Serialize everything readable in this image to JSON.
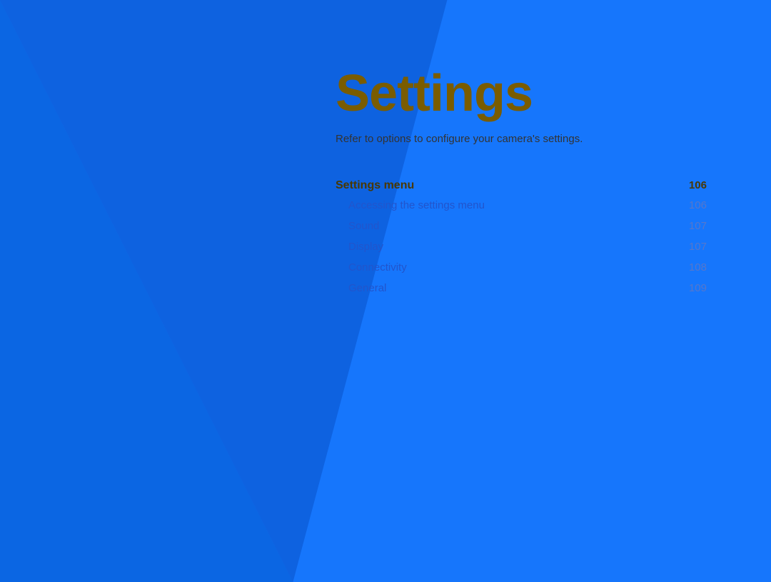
{
  "background": {
    "color": "#1a7aff"
  },
  "page": {
    "title": "Settings",
    "subtitle": "Refer to options to configure your camera's settings.",
    "toc": {
      "section_label": "Settings menu",
      "section_page": "106",
      "items": [
        {
          "label": "Accessing the settings menu",
          "page": "106"
        },
        {
          "label": "Sound",
          "page": "107"
        },
        {
          "label": "Display",
          "page": "107"
        },
        {
          "label": "Connectivity",
          "page": "108"
        },
        {
          "label": "General",
          "page": "109"
        }
      ]
    }
  }
}
